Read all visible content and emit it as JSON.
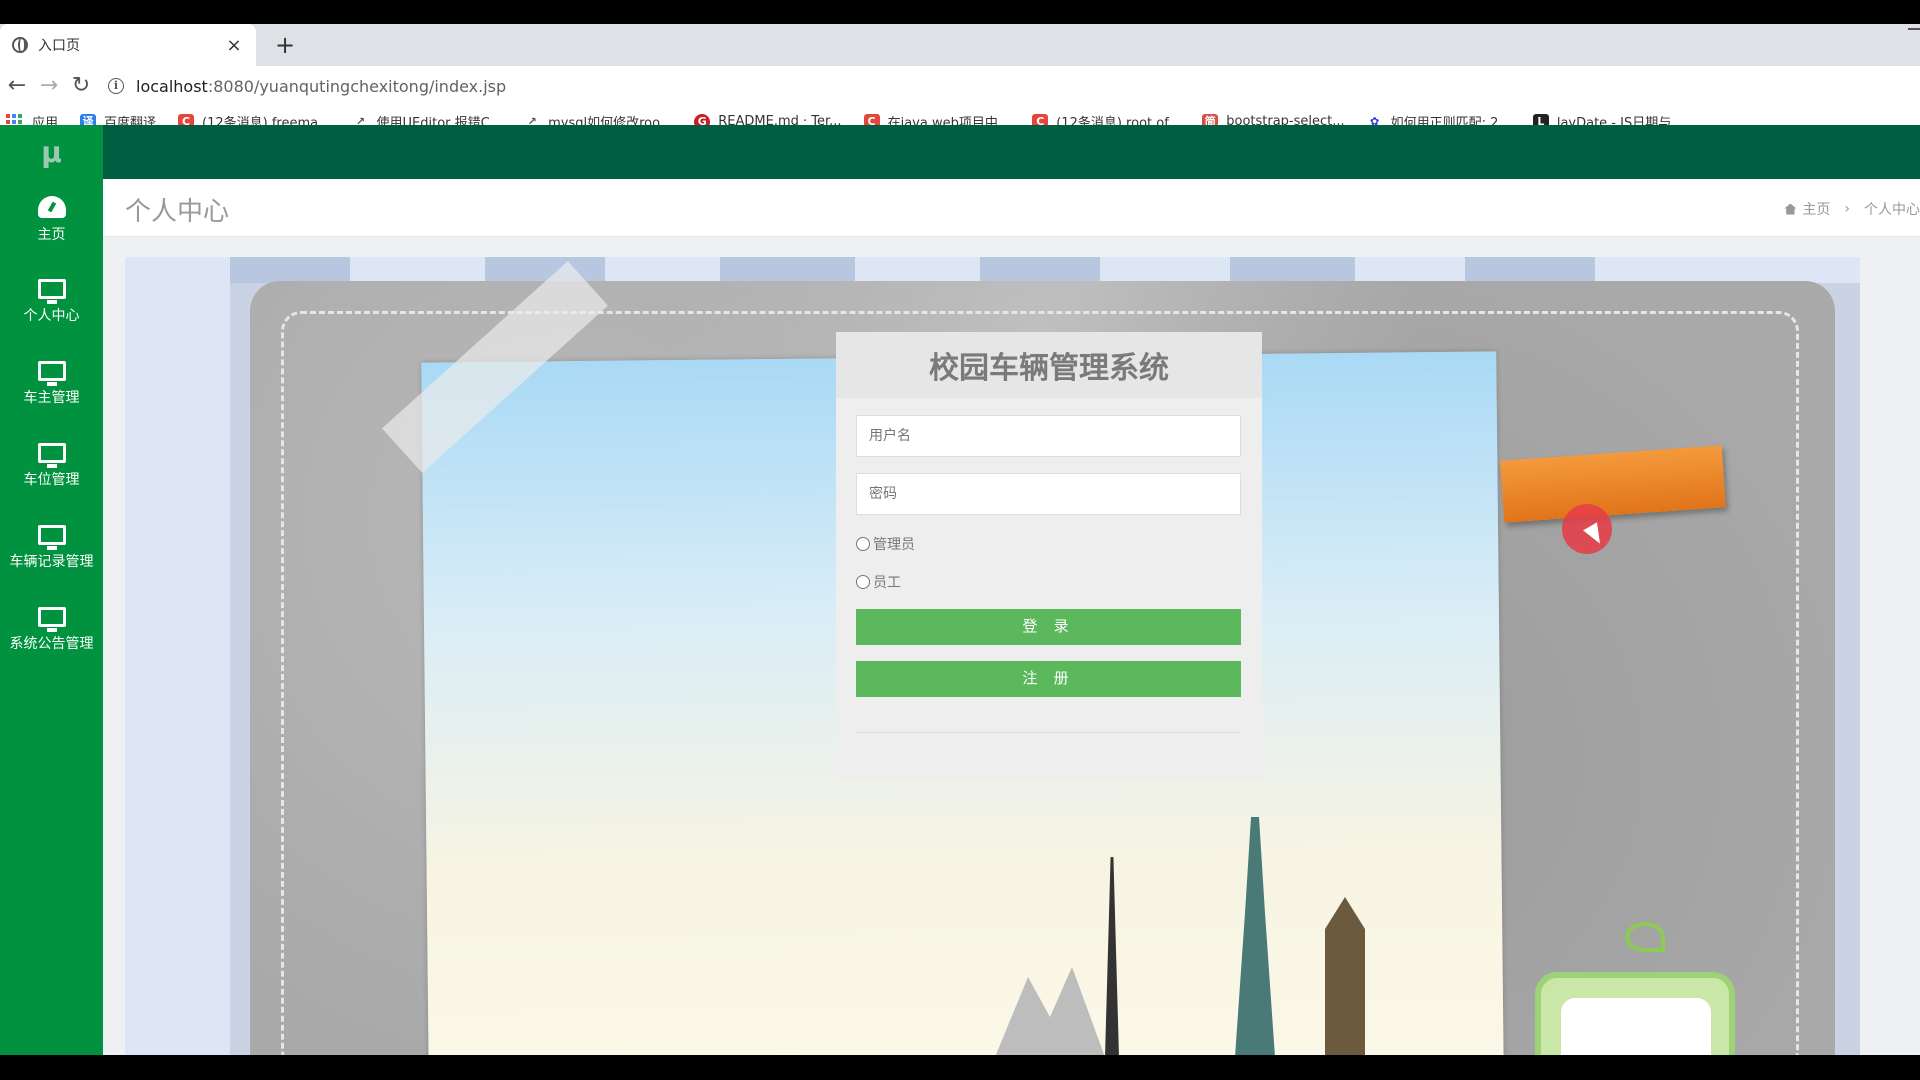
{
  "browser": {
    "tab_title": "入口页",
    "tab_close": "×",
    "new_tab": "+",
    "url_host": "localhost",
    "url_rest": ":8080/yuanqutingchexitong/index.jsp",
    "nav": {
      "back": "←",
      "forward": "→",
      "reload": "↻"
    },
    "bookmarks": [
      {
        "label": "应用",
        "icon": "apps-grid-icon"
      },
      {
        "label": "百度翻译",
        "icon": "baidu-translate-icon",
        "color": "#2b7de9",
        "glyph": "译"
      },
      {
        "label": "(12条消息) freema...",
        "icon": "csdn-icon",
        "color": "#e4473a",
        "glyph": "C"
      },
      {
        "label": "使用UEditor 报错C...",
        "icon": "link-icon",
        "color": "#555555",
        "glyph": "↗"
      },
      {
        "label": "mysql如何修改roo...",
        "icon": "link-icon",
        "color": "#555555",
        "glyph": "↗"
      },
      {
        "label": "README.md · Ter...",
        "icon": "gitee-icon",
        "color": "#c71d23",
        "glyph": "G"
      },
      {
        "label": "在java web项目中...",
        "icon": "csdn-icon",
        "color": "#e4473a",
        "glyph": "C"
      },
      {
        "label": "(12条消息) root of...",
        "icon": "csdn-icon",
        "color": "#e4473a",
        "glyph": "C"
      },
      {
        "label": "bootstrap-select...",
        "icon": "cnblogs-icon",
        "color": "#d35147",
        "glyph": "简"
      },
      {
        "label": "如何用正则匹配: 2...",
        "icon": "baidu-icon",
        "color": "#2932e1",
        "glyph": "✿"
      },
      {
        "label": "layDate - JS日期与...",
        "icon": "layui-icon",
        "color": "#222222",
        "glyph": "L"
      }
    ]
  },
  "app": {
    "logo": "μ",
    "sidebar": [
      {
        "label": "主页",
        "icon": "dashboard-icon"
      },
      {
        "label": "个人中心",
        "icon": "monitor-icon"
      },
      {
        "label": "车主管理",
        "icon": "monitor-icon"
      },
      {
        "label": "车位管理",
        "icon": "monitor-icon"
      },
      {
        "label": "车辆记录管理",
        "icon": "monitor-icon"
      },
      {
        "label": "系统公告管理",
        "icon": "monitor-icon"
      }
    ],
    "page_title": "个人中心",
    "breadcrumb": {
      "home": "主页",
      "separator": "›",
      "current": "个人中心"
    },
    "colors": {
      "topbar": "#005e43",
      "sidebar": "#00923e",
      "button": "#5cb85c"
    }
  },
  "login": {
    "title": "校园车辆管理系统",
    "username_placeholder": "用户名",
    "password_placeholder": "密码",
    "roles": [
      "管理员",
      "员工"
    ],
    "login_button": "登 录",
    "register_button": "注 册"
  }
}
